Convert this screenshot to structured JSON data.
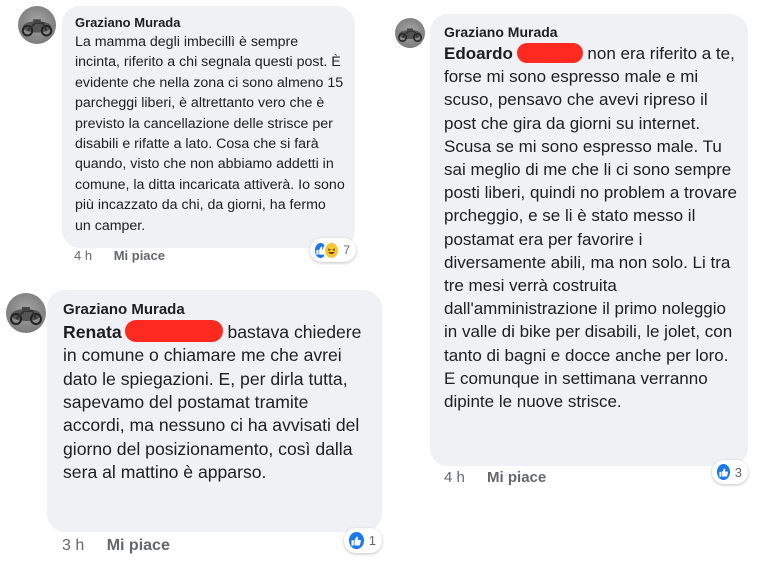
{
  "comments": [
    {
      "author": "Graziano Murada",
      "mention": "",
      "text": "La mamma degli imbecillì è sempre incinta, riferito a chi segnala questi post. È evidente che nella zona ci sono almeno 15 parcheggi liberi, è altrettanto vero che è previsto la cancellazione delle strisce per disabili e rifatte a lato. Cosa che si farà quando, visto che non abbiamo addetti in comune, la ditta incaricata attiverà. Io sono più incazzato da chi, da giorni, ha fermo un camper.",
      "time": "4 h",
      "like_label": "Mi piace",
      "reaction_count": "7",
      "reaction_icons": [
        "like-icon",
        "haha-icon"
      ]
    },
    {
      "author": "Graziano Murada",
      "mention": "Renata",
      "text": "bastava chiedere in comune o chiamare me che avrei dato le spiegazioni. E, per dirla tutta, sapevamo del postamat tramite accordi, ma nessuno ci ha avvisati del giorno del posizionamento, così dalla sera al mattino è apparso.",
      "time": "3 h",
      "like_label": "Mi piace",
      "reaction_count": "1",
      "reaction_icons": [
        "like-icon"
      ]
    },
    {
      "author": "Graziano Murada",
      "mention": "Edoardo",
      "text": "non era riferito a te, forse mi sono espresso male e mi scuso, pensavo che avevi ripreso il post che gira da giorni su internet. Scusa se mi sono espresso male. Tu sai meglio di me che li ci sono sempre posti liberi, quindi no problem a trovare prcheggio, e se li è stato messo il postamat era per favorire i diversamente abili, ma non solo. Li tra tre mesi verrà costruita dall'amministrazione il primo noleggio in valle di bike per disabili, le jolet, con tanto di bagni e docce anche per loro. E comunque in settimana verranno dipinte le nuove strisce.",
      "time": "4 h",
      "like_label": "Mi piace",
      "reaction_count": "3",
      "reaction_icons": [
        "like-icon"
      ]
    }
  ],
  "colors": {
    "bubble": "#eff1f4",
    "redaction": "#ff2a1f",
    "like_blue": "#1877f2",
    "meta_gray": "#65676b"
  }
}
